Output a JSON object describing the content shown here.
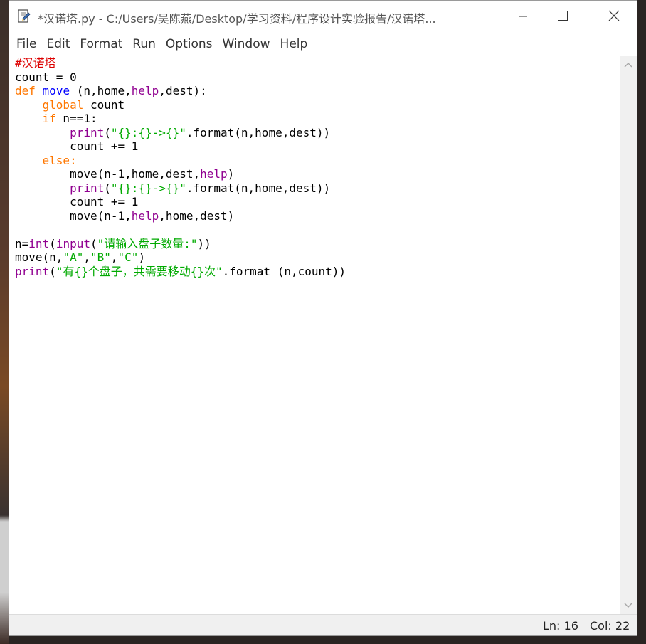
{
  "window": {
    "title": "*汉诺塔.py - C:/Users/吴陈燕/Desktop/学习资料/程序设计实验报告/汉诺塔...",
    "minimize_icon": "minimize-icon",
    "maximize_icon": "maximize-icon",
    "close_icon": "close-icon"
  },
  "menu": {
    "file": "File",
    "edit": "Edit",
    "format": "Format",
    "run": "Run",
    "options": "Options",
    "window": "Window",
    "help": "Help"
  },
  "code": {
    "l1_comment": "#汉诺塔",
    "l2": "count = 0",
    "l3_kw": "def",
    "l3_name": "move",
    "l3_rest_a": " (n,home,",
    "l3_bi": "help",
    "l3_rest_b": ",dest):",
    "l4_kw": "global",
    "l4_rest": " count",
    "l5_kw": "if",
    "l5_rest": " n==1:",
    "l6_bi": "print",
    "l6_paren": "(",
    "l6_str": "\"{}:{}->{}\"",
    "l6_rest": ".format(n,home,dest))",
    "l7": "count += 1",
    "l8_kw": "else",
    "l8_rest": ":",
    "l9_a": "move(n-1,home,dest,",
    "l9_bi": "help",
    "l9_b": ")",
    "l10_bi": "print",
    "l10_paren": "(",
    "l10_str": "\"{}:{}->{}\"",
    "l10_rest": ".format(n,home,dest))",
    "l11": "count += 1",
    "l12_a": "move(n-1,",
    "l12_bi": "help",
    "l12_b": ",home,dest)",
    "l14_a": "n=",
    "l14_bi1": "int",
    "l14_p1": "(",
    "l14_bi2": "input",
    "l14_p2": "(",
    "l14_str": "\"请输入盘子数量:\"",
    "l14_end": "))",
    "l15_a": "move(n,",
    "l15_s1": "\"A\"",
    "l15_c1": ",",
    "l15_s2": "\"B\"",
    "l15_c2": ",",
    "l15_s3": "\"C\"",
    "l15_end": ")",
    "l16_bi": "print",
    "l16_paren": "(",
    "l16_str": "\"有{}个盘子，共需要移动{}次\"",
    "l16_rest": ".format (n,count))"
  },
  "status": {
    "ln": "Ln: 16",
    "col": "Col: 22"
  }
}
